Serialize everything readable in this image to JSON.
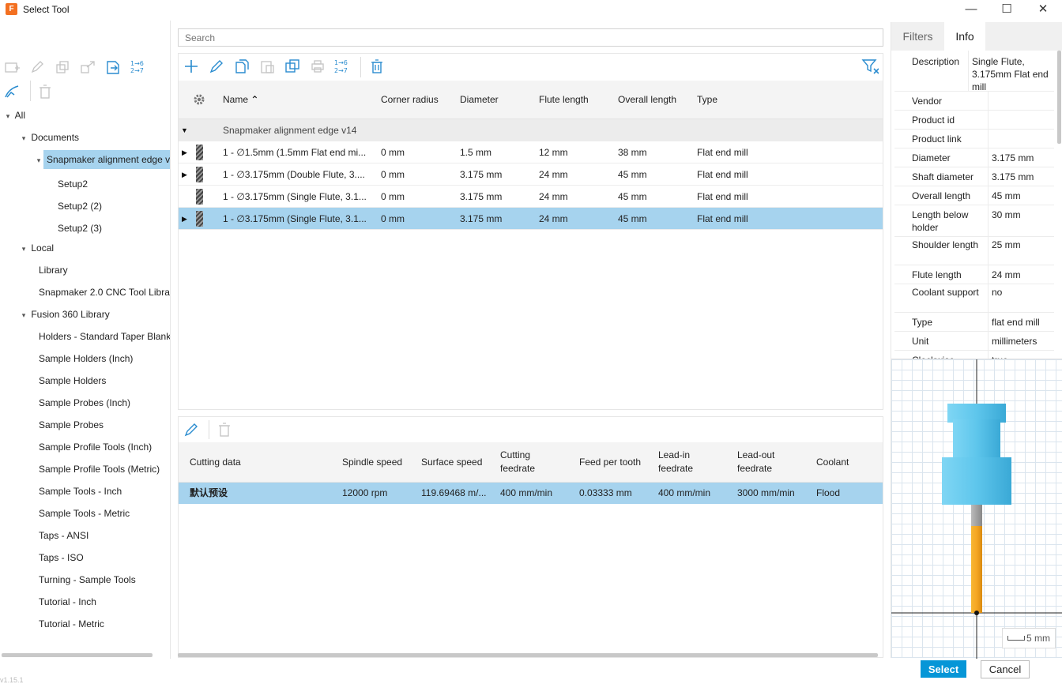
{
  "window": {
    "title": "Select Tool",
    "minimize_glyph": "—",
    "maximize_glyph": "☐",
    "close_glyph": "✕"
  },
  "search": {
    "placeholder": "Search"
  },
  "tree": {
    "items": [
      {
        "label": "All",
        "caret": "▾"
      },
      {
        "label": "Documents",
        "caret": "▾"
      },
      {
        "label": "Snapmaker alignment edge v14",
        "caret": "▾"
      },
      {
        "label": "Setup2"
      },
      {
        "label": "Setup2 (2)"
      },
      {
        "label": "Setup2 (3)"
      },
      {
        "label": "Local",
        "caret": "▾"
      },
      {
        "label": "Library"
      },
      {
        "label": "Snapmaker 2.0 CNC Tool Library"
      },
      {
        "label": "Fusion 360 Library",
        "caret": "▾"
      },
      {
        "label": "Holders - Standard Taper Blanks"
      },
      {
        "label": "Sample Holders (Inch)"
      },
      {
        "label": "Sample Holders"
      },
      {
        "label": "Sample Probes (Inch)"
      },
      {
        "label": "Sample Probes"
      },
      {
        "label": "Sample Profile Tools (Inch)"
      },
      {
        "label": "Sample Profile Tools (Metric)"
      },
      {
        "label": "Sample Tools - Inch"
      },
      {
        "label": "Sample Tools - Metric"
      },
      {
        "label": "Taps - ANSI"
      },
      {
        "label": "Taps - ISO"
      },
      {
        "label": "Turning - Sample Tools"
      },
      {
        "label": "Tutorial - Inch"
      },
      {
        "label": "Tutorial - Metric"
      }
    ]
  },
  "tools_table": {
    "columns": [
      "Name",
      "Corner radius",
      "Diameter",
      "Flute length",
      "Overall length",
      "Type"
    ],
    "sort_indicator": "⌃",
    "group": "Snapmaker alignment edge v14",
    "rows": [
      {
        "name": "1 - ∅1.5mm (1.5mm Flat end mi...",
        "corner_radius": "0 mm",
        "diameter": "1.5 mm",
        "flute_length": "12 mm",
        "overall_length": "38 mm",
        "type": "Flat end mill"
      },
      {
        "name": "1 - ∅3.175mm (Double Flute, 3....",
        "corner_radius": "0 mm",
        "diameter": "3.175 mm",
        "flute_length": "24 mm",
        "overall_length": "45 mm",
        "type": "Flat end mill"
      },
      {
        "name": "1 - ∅3.175mm (Single Flute, 3.1...",
        "corner_radius": "0 mm",
        "diameter": "3.175 mm",
        "flute_length": "24 mm",
        "overall_length": "45 mm",
        "type": "Flat end mill"
      },
      {
        "name": "1 - ∅3.175mm (Single Flute, 3.1...",
        "corner_radius": "0 mm",
        "diameter": "3.175 mm",
        "flute_length": "24 mm",
        "overall_length": "45 mm",
        "type": "Flat end mill"
      }
    ],
    "toolbar_icons": [
      "plus-icon",
      "pencil-icon",
      "copy-icon",
      "paste-icon",
      "duplicate-icon",
      "print-icon",
      "renumber-icon",
      "trash-icon",
      "filter-clear-icon"
    ],
    "renumber_label": "1→6\n2→7"
  },
  "cutting_table": {
    "columns": [
      "Cutting data",
      "Spindle speed",
      "Surface speed",
      "Cutting feedrate",
      "Feed per tooth",
      "Lead-in feedrate",
      "Lead-out feedrate",
      "Coolant"
    ],
    "col_line1": [
      "Cutting data",
      "Spindle speed",
      "Surface speed",
      "Cutting",
      "Feed per tooth",
      "Lead-in",
      "Lead-out",
      "Coolant"
    ],
    "col_line2": [
      "",
      "",
      "",
      "feedrate",
      "",
      "feedrate",
      "feedrate",
      ""
    ],
    "row": {
      "cutting_data": "默认预设",
      "spindle_speed": "12000 rpm",
      "surface_speed": "119.69468 m/...",
      "cutting_feedrate": "400 mm/min",
      "feed_per_tooth": "0.03333 mm",
      "lead_in_feedrate": "400 mm/min",
      "lead_out_feedrate": "3000 mm/min",
      "coolant": "Flood"
    }
  },
  "right_panel": {
    "tabs": [
      "Filters",
      "Info"
    ],
    "active_tab": "Info",
    "info": [
      {
        "key": "Description",
        "value": "Single Flute, 3.175mm Flat end mill"
      },
      {
        "key": "Vendor",
        "value": ""
      },
      {
        "key": "Product id",
        "value": ""
      },
      {
        "key": "Product link",
        "value": ""
      },
      {
        "key": "Diameter",
        "value": "3.175 mm"
      },
      {
        "key": "Shaft diameter",
        "value": "3.175 mm"
      },
      {
        "key": "Overall length",
        "value": "45 mm"
      },
      {
        "key": "Length below holder",
        "value": "30 mm"
      },
      {
        "key": "Shoulder length",
        "value": "25 mm"
      },
      {
        "key": "Flute length",
        "value": "24 mm"
      },
      {
        "key": "Coolant support",
        "value": "no"
      },
      {
        "key": "Type",
        "value": "flat end mill"
      },
      {
        "key": "Unit",
        "value": "millimeters"
      },
      {
        "key": "Clockwise",
        "value": "true"
      }
    ],
    "scale_label": "5 mm"
  },
  "buttons": {
    "select": "Select",
    "cancel": "Cancel"
  },
  "version": "v1.15.1",
  "colors": {
    "selection": "#a6d3ee",
    "accent": "#0696d7",
    "icon_blue": "#2a8ccf",
    "holder": "#5fc8ee",
    "flute": "#f5a623"
  }
}
